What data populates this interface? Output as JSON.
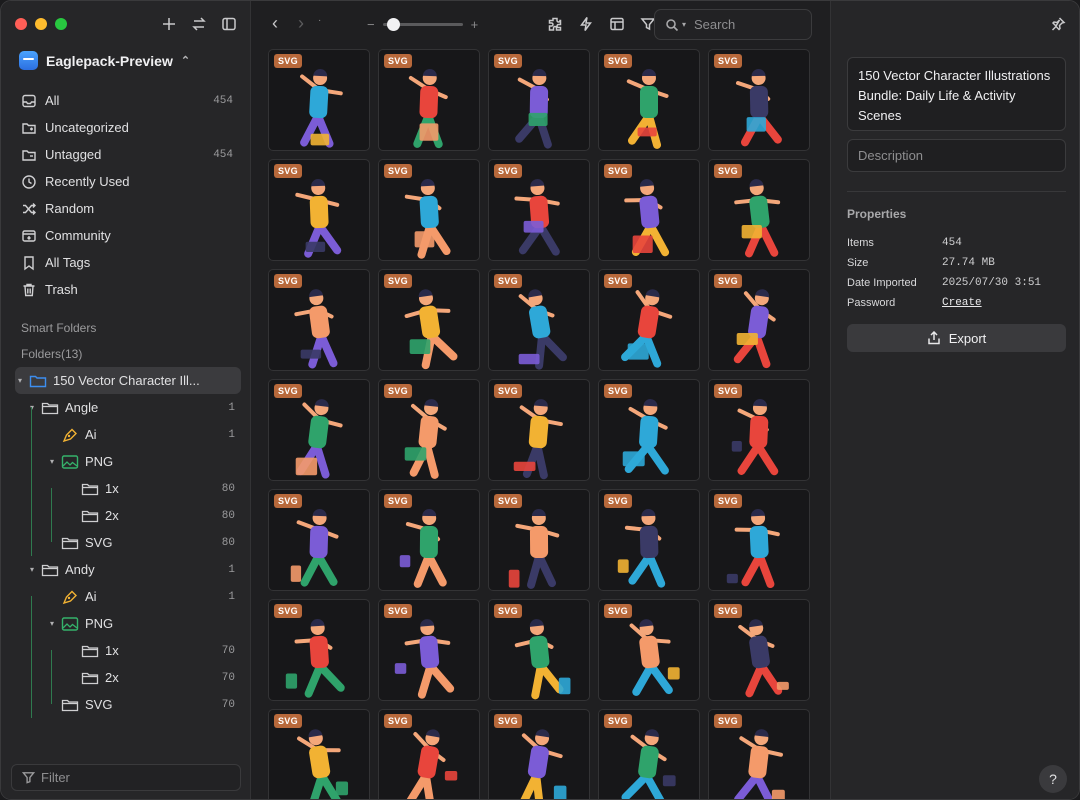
{
  "sidebar": {
    "library_name": "Eaglepack-Preview",
    "nav": [
      {
        "label": "All",
        "count": "454",
        "icon": "all-icon"
      },
      {
        "label": "Uncategorized",
        "count": "",
        "icon": "uncategorized-icon"
      },
      {
        "label": "Untagged",
        "count": "454",
        "icon": "untagged-icon"
      },
      {
        "label": "Recently Used",
        "count": "",
        "icon": "clock-icon"
      },
      {
        "label": "Random",
        "count": "",
        "icon": "shuffle-icon"
      },
      {
        "label": "Community",
        "count": "",
        "icon": "community-icon"
      },
      {
        "label": "All Tags",
        "count": "",
        "icon": "bookmark-icon"
      },
      {
        "label": "Trash",
        "count": "",
        "icon": "trash-icon"
      }
    ],
    "smart_folders_label": "Smart Folders",
    "folders_label": "Folders(13)",
    "tree": [
      {
        "label": "150 Vector Character Ill...",
        "count": "",
        "type": "folder-blue",
        "depth": 0,
        "caret": "▾",
        "selected": true
      },
      {
        "label": "Angle",
        "count": "1",
        "type": "folder",
        "depth": 1,
        "caret": "▾"
      },
      {
        "label": "Ai",
        "count": "1",
        "type": "pen",
        "depth": 2,
        "caret": ""
      },
      {
        "label": "PNG",
        "count": "",
        "type": "image",
        "depth": 2,
        "caret": "▾"
      },
      {
        "label": "1x",
        "count": "80",
        "type": "folder",
        "depth": 3,
        "caret": ""
      },
      {
        "label": "2x",
        "count": "80",
        "type": "folder",
        "depth": 3,
        "caret": ""
      },
      {
        "label": "SVG",
        "count": "80",
        "type": "folder",
        "depth": 2,
        "caret": ""
      },
      {
        "label": "Andy",
        "count": "1",
        "type": "folder",
        "depth": 1,
        "caret": "▾"
      },
      {
        "label": "Ai",
        "count": "1",
        "type": "pen",
        "depth": 2,
        "caret": ""
      },
      {
        "label": "PNG",
        "count": "",
        "type": "image",
        "depth": 2,
        "caret": "▾"
      },
      {
        "label": "1x",
        "count": "70",
        "type": "folder",
        "depth": 3,
        "caret": ""
      },
      {
        "label": "2x",
        "count": "70",
        "type": "folder",
        "depth": 3,
        "caret": ""
      },
      {
        "label": "SVG",
        "count": "70",
        "type": "folder",
        "depth": 2,
        "caret": ""
      }
    ],
    "filter_placeholder": "Filter"
  },
  "toolbar": {
    "search_placeholder": "Search",
    "zoom_level": 0.05
  },
  "grid": {
    "badge": "SVG",
    "item_count_visible": 35
  },
  "inspector": {
    "title": "150 Vector Character Illustrations Bundle: Daily Life & Activity Scenes",
    "description_placeholder": "Description",
    "properties_label": "Properties",
    "properties": [
      {
        "key": "Items",
        "value": "454",
        "link": false
      },
      {
        "key": "Size",
        "value": "27.74 MB",
        "link": false
      },
      {
        "key": "Date Imported",
        "value": "2025/07/30 3:51",
        "link": false
      },
      {
        "key": "Password",
        "value": "Create",
        "link": true
      }
    ],
    "export_label": "Export",
    "help_label": "?"
  },
  "colors": {
    "badge": "#b8693b",
    "accent_blue": "#3d8ef0",
    "guide_green": "#2f7a4f",
    "palette": [
      "#e8453c",
      "#2ea8d8",
      "#f2b233",
      "#3a3a66",
      "#f49a6a",
      "#2fa36b",
      "#7b5cd6"
    ]
  }
}
